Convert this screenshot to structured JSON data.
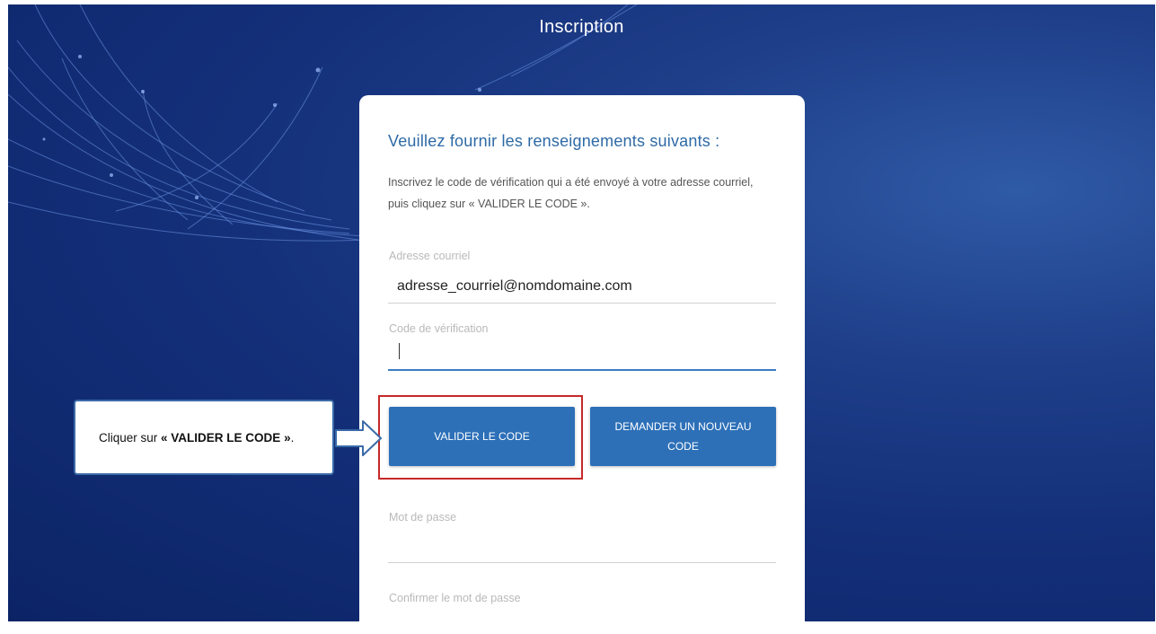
{
  "page": {
    "title": "Inscription"
  },
  "form": {
    "heading": "Veuillez fournir les renseignements suivants :",
    "intro": "Inscrivez le code de vérification qui a été envoyé à votre adresse courriel, puis cliquez sur « VALIDER LE CODE ».",
    "email": {
      "label": "Adresse courriel",
      "value": "adresse_courriel@nomdomaine.com"
    },
    "code": {
      "label": "Code de vérification",
      "value": ""
    },
    "validate_button": "VALIDER LE CODE",
    "new_code_button": "DEMANDER UN NOUVEAU CODE",
    "password": {
      "label": "Mot de passe"
    },
    "confirm_password": {
      "label": "Confirmer le mot de passe"
    }
  },
  "callout": {
    "prefix": "Cliquer sur ",
    "emphasis": "« VALIDER LE CODE »",
    "suffix": "."
  },
  "colors": {
    "primary_button": "#2d70b8",
    "highlight_border": "#c62828",
    "heading": "#2e6aa6"
  }
}
